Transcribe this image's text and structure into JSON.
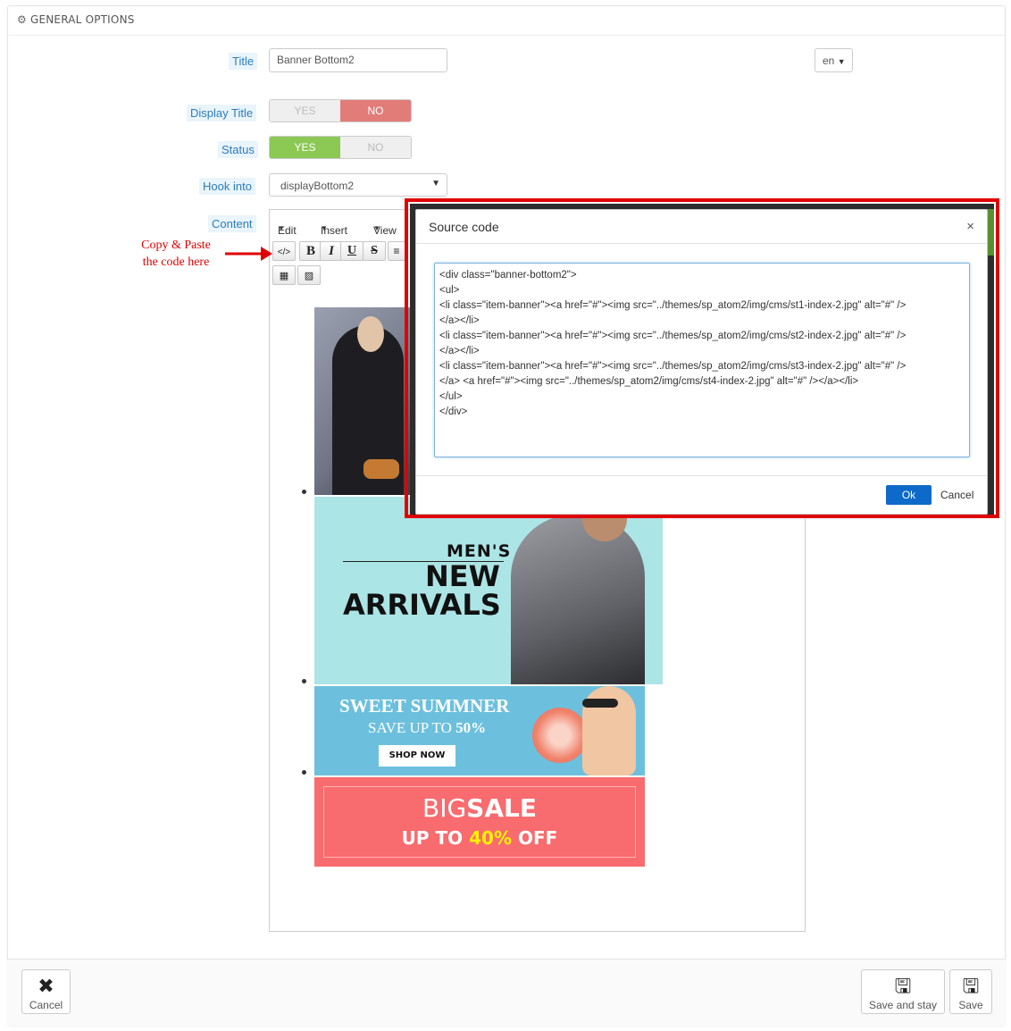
{
  "panel": {
    "heading": "General options"
  },
  "form": {
    "title_label": "Title",
    "title_value": "Banner Bottom2",
    "lang": "en",
    "display_title_label": "Display Title",
    "status_label": "Status",
    "yes": "YES",
    "no": "NO",
    "hook_label": "Hook into",
    "hook_value": "displayBottom2",
    "content_label": "Content"
  },
  "editor": {
    "menu": [
      "Edit",
      "Insert",
      "View"
    ]
  },
  "annotation": {
    "line1": "Copy & Paste",
    "line2": "the code here"
  },
  "banners": {
    "b2_line1": "MEN'S",
    "b2_line2": "NEW",
    "b2_line3": "ARRIVALS",
    "b3_line1": "SWEET SUMMNER",
    "b3_line2_prefix": "SAVE UP TO ",
    "b3_line2_value": "50%",
    "b3_button": "SHOP NOW",
    "b4_big": "BIG",
    "b4_sale": "SALE",
    "b4_up_prefix": "UP TO ",
    "b4_up_value": "40%",
    "b4_up_suffix": " OFF"
  },
  "modal": {
    "title": "Source code",
    "close": "×",
    "code": "<div class=\"banner-bottom2\">\n<ul>\n<li class=\"item-banner\"><a href=\"#\"><img src=\"../themes/sp_atom2/img/cms/st1-index-2.jpg\" alt=\"#\" />\n</a></li>\n<li class=\"item-banner\"><a href=\"#\"><img src=\"../themes/sp_atom2/img/cms/st2-index-2.jpg\" alt=\"#\" />\n</a></li>\n<li class=\"item-banner\"><a href=\"#\"><img src=\"../themes/sp_atom2/img/cms/st3-index-2.jpg\" alt=\"#\" />\n</a> <a href=\"#\"><img src=\"../themes/sp_atom2/img/cms/st4-index-2.jpg\" alt=\"#\" /></a></li>\n</ul>\n</div>",
    "ok": "Ok",
    "cancel": "Cancel"
  },
  "footer": {
    "cancel": "Cancel",
    "save_and_stay": "Save and stay",
    "save": "Save"
  }
}
